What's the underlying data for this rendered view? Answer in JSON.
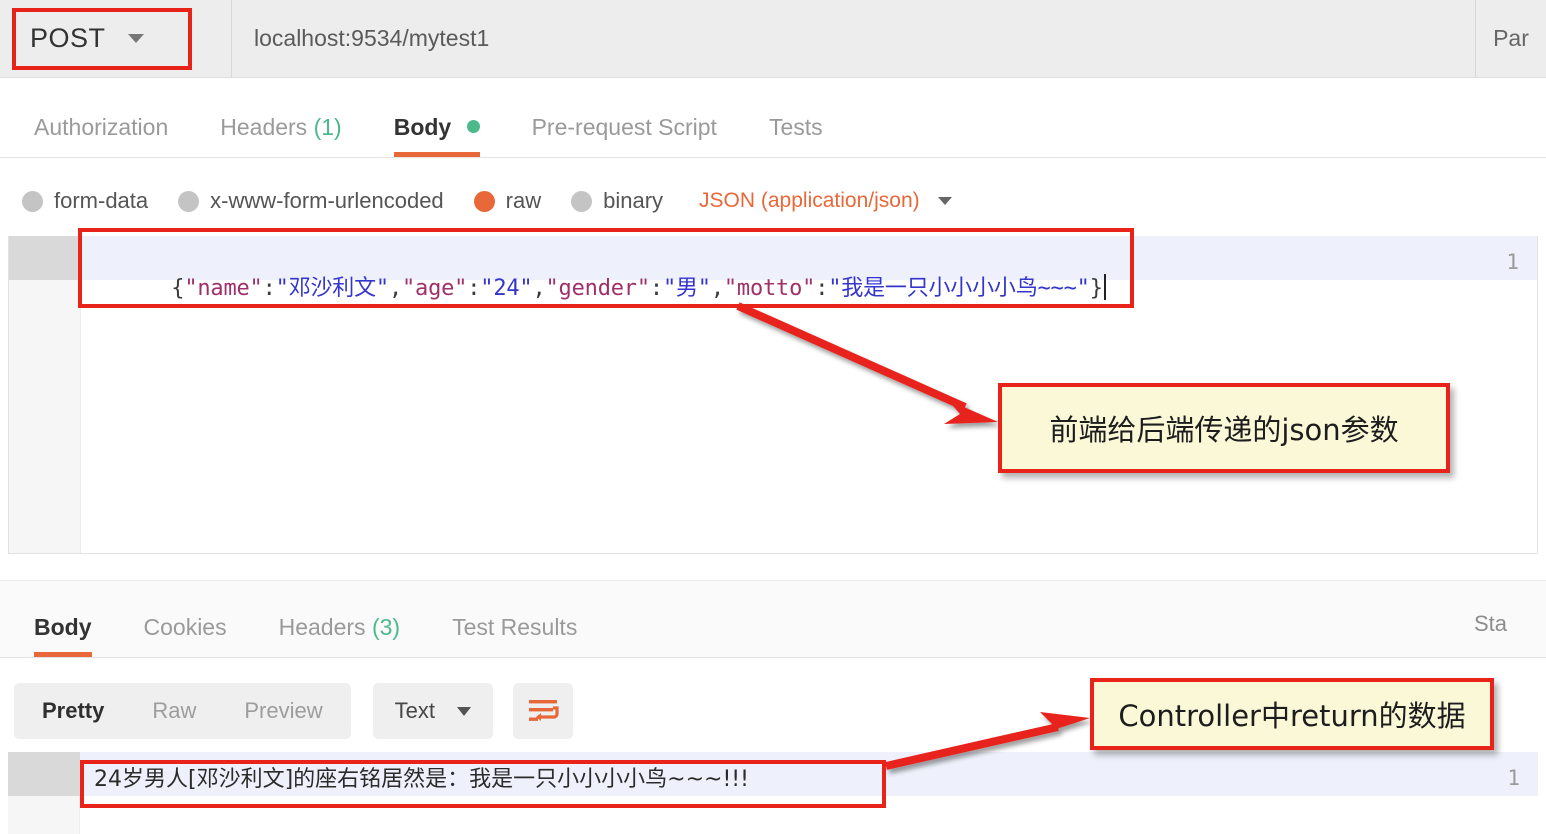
{
  "request": {
    "method": "POST",
    "url": "localhost:9534/mytest1",
    "params_label": "Par",
    "tabs": [
      {
        "label": "Authorization",
        "count": "",
        "active": false
      },
      {
        "label": "Headers",
        "count": "(1)",
        "active": false
      },
      {
        "label": "Body",
        "count": "",
        "active": true,
        "dot": true
      },
      {
        "label": "Pre-request Script",
        "count": "",
        "active": false
      },
      {
        "label": "Tests",
        "count": "",
        "active": false
      }
    ],
    "body_types": [
      {
        "label": "form-data",
        "checked": false
      },
      {
        "label": "x-www-form-urlencoded",
        "checked": false
      },
      {
        "label": "raw",
        "checked": true
      },
      {
        "label": "binary",
        "checked": false
      }
    ],
    "content_type": "JSON (application/json)",
    "editor": {
      "line_number": "1",
      "tokens": [
        {
          "t": "{",
          "k": "punc"
        },
        {
          "t": "\"name\"",
          "k": "key"
        },
        {
          "t": ":",
          "k": "punc"
        },
        {
          "t": "\"邓沙利文\"",
          "k": "val"
        },
        {
          "t": ",",
          "k": "punc"
        },
        {
          "t": "\"age\"",
          "k": "key"
        },
        {
          "t": ":",
          "k": "punc"
        },
        {
          "t": "\"24\"",
          "k": "val"
        },
        {
          "t": ",",
          "k": "punc"
        },
        {
          "t": "\"gender\"",
          "k": "key"
        },
        {
          "t": ":",
          "k": "punc"
        },
        {
          "t": "\"男\"",
          "k": "val"
        },
        {
          "t": ",",
          "k": "punc"
        },
        {
          "t": "\"motto\"",
          "k": "key"
        },
        {
          "t": ":",
          "k": "punc"
        },
        {
          "t": "\"我是一只小小小小鸟~~~\"",
          "k": "val"
        },
        {
          "t": "}",
          "k": "punc"
        }
      ],
      "raw": "{\"name\":\"邓沙利文\",\"age\":\"24\",\"gender\":\"男\",\"motto\":\"我是一只小小小小鸟~~~\"}"
    }
  },
  "response": {
    "tabs": [
      {
        "label": "Body",
        "count": "",
        "active": true
      },
      {
        "label": "Cookies",
        "count": "",
        "active": false
      },
      {
        "label": "Headers",
        "count": "(3)",
        "active": false
      },
      {
        "label": "Test Results",
        "count": "",
        "active": false
      }
    ],
    "status_label": "Sta",
    "view_modes": [
      {
        "label": "Pretty",
        "active": true
      },
      {
        "label": "Raw",
        "active": false
      },
      {
        "label": "Preview",
        "active": false
      }
    ],
    "format": "Text",
    "wrap_icon": "word-wrap-icon",
    "editor": {
      "line_number": "1",
      "text": "24岁男人[邓沙利文]的座右铭居然是：我是一只小小小小鸟~~~!!!"
    }
  },
  "annotations": {
    "callout_request": "前端给后端传递的json参数",
    "callout_response": "Controller中return的数据",
    "highlight_color": "#e8231a",
    "callout_bg": "#fbf8d8"
  },
  "colors": {
    "accent": "#e8683a",
    "green": "#4bb98a",
    "json_key": "#a0306a",
    "json_value": "#3434cf"
  }
}
